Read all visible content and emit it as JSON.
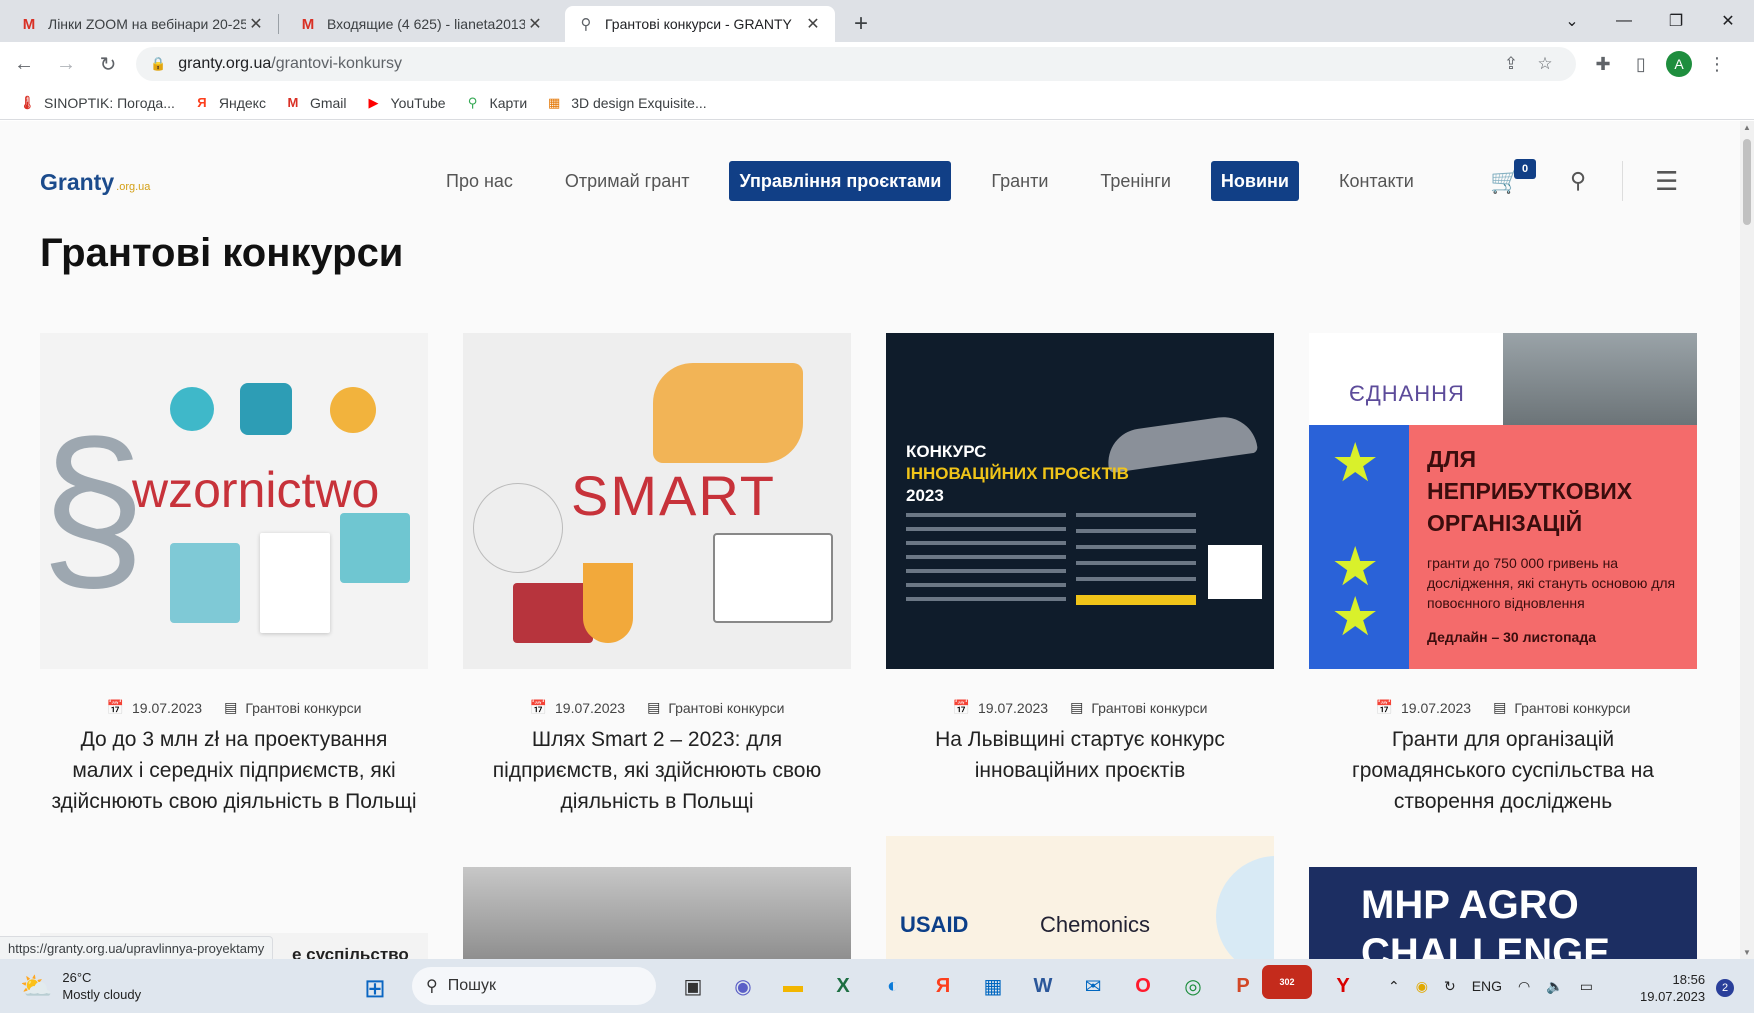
{
  "browser": {
    "tabs": [
      {
        "title": "Лінки ZOOM на вебінари 20-25",
        "icon": "gmail-icon",
        "active": false
      },
      {
        "title": "Входящие (4 625) - lianeta2013@",
        "icon": "gmail-icon",
        "active": false
      },
      {
        "title": "Грантові конкурси - GRANTY",
        "icon": "granty-favicon",
        "active": true
      }
    ],
    "url_host": "granty.org.ua",
    "url_path": "/grantovi-konkursy",
    "avatar_letter": "A",
    "bookmarks": [
      {
        "label": "SINOPTIK: Погода..."
      },
      {
        "label": "Яндекс"
      },
      {
        "label": "Gmail"
      },
      {
        "label": "YouTube"
      },
      {
        "label": "Карти"
      },
      {
        "label": "3D design Exquisite..."
      }
    ],
    "status_url": "https://granty.org.ua/upravlinnya-proyektamy"
  },
  "site": {
    "logo": "Granty",
    "logo_sub": ".org.ua",
    "menu": [
      {
        "label": "Про нас",
        "highlight": false
      },
      {
        "label": "Отримай грант",
        "highlight": false
      },
      {
        "label": "Управління проєктами",
        "highlight": true
      },
      {
        "label": "Гранти",
        "highlight": false
      },
      {
        "label": "Тренінги",
        "highlight": false
      },
      {
        "label": "Новини",
        "highlight": true
      },
      {
        "label": "Контакти",
        "highlight": false
      }
    ],
    "cart_count": "0",
    "page_title": "Грантові конкурси",
    "brand_color": "#113f86"
  },
  "cards": [
    {
      "date": "19.07.2023",
      "category": "Грантові конкурси",
      "title": "До до 3 млн zł на проектування малих і середніх підприємств, які здійснюють свою діяльність в Польщі",
      "image_word": "wzornictwo"
    },
    {
      "date": "19.07.2023",
      "category": "Грантові конкурси",
      "title": "Шлях Smart 2 – 2023: для підприємств, які здійснюють свою діяльність в Польщі",
      "image_word": "SMART"
    },
    {
      "date": "19.07.2023",
      "category": "Грантові конкурси",
      "title": "На Львівщині стартує конкурс інноваційних проєктів",
      "image_line1": "КОНКУРС",
      "image_line2": "ІННОВАЦІЙНИХ ПРОЄКТІВ",
      "image_line3": "2023"
    },
    {
      "date": "19.07.2023",
      "category": "Грантові конкурси",
      "title": "Гранти для організацій громадянського суспільства на створення досліджень",
      "image_logo": "ЄДНАННЯ",
      "image_head1": "ДЛЯ",
      "image_head2": "НЕПРИБУТКОВИХ",
      "image_head3": "ОРГАНІЗАЦІЙ",
      "image_text": "гранти до 750 000 гривень на дослідження, які стануть основою для повоєнного відновлення",
      "image_deadline": "Дедлайн – 30 листопада"
    }
  ],
  "more_cards": {
    "card5_text": "е суспільство",
    "card7_usaid": "USAID",
    "card7_chemonics": "Chemonics",
    "card8_line1": "MHP AGRO",
    "card8_line2": "CHALLENGE"
  },
  "taskbar": {
    "temp": "26°C",
    "weather": "Mostly cloudy",
    "search_placeholder": "Пошук",
    "viber_badge": "302",
    "lang": "ENG",
    "time": "18:56",
    "date": "19.07.2023",
    "notif_count": "2"
  }
}
